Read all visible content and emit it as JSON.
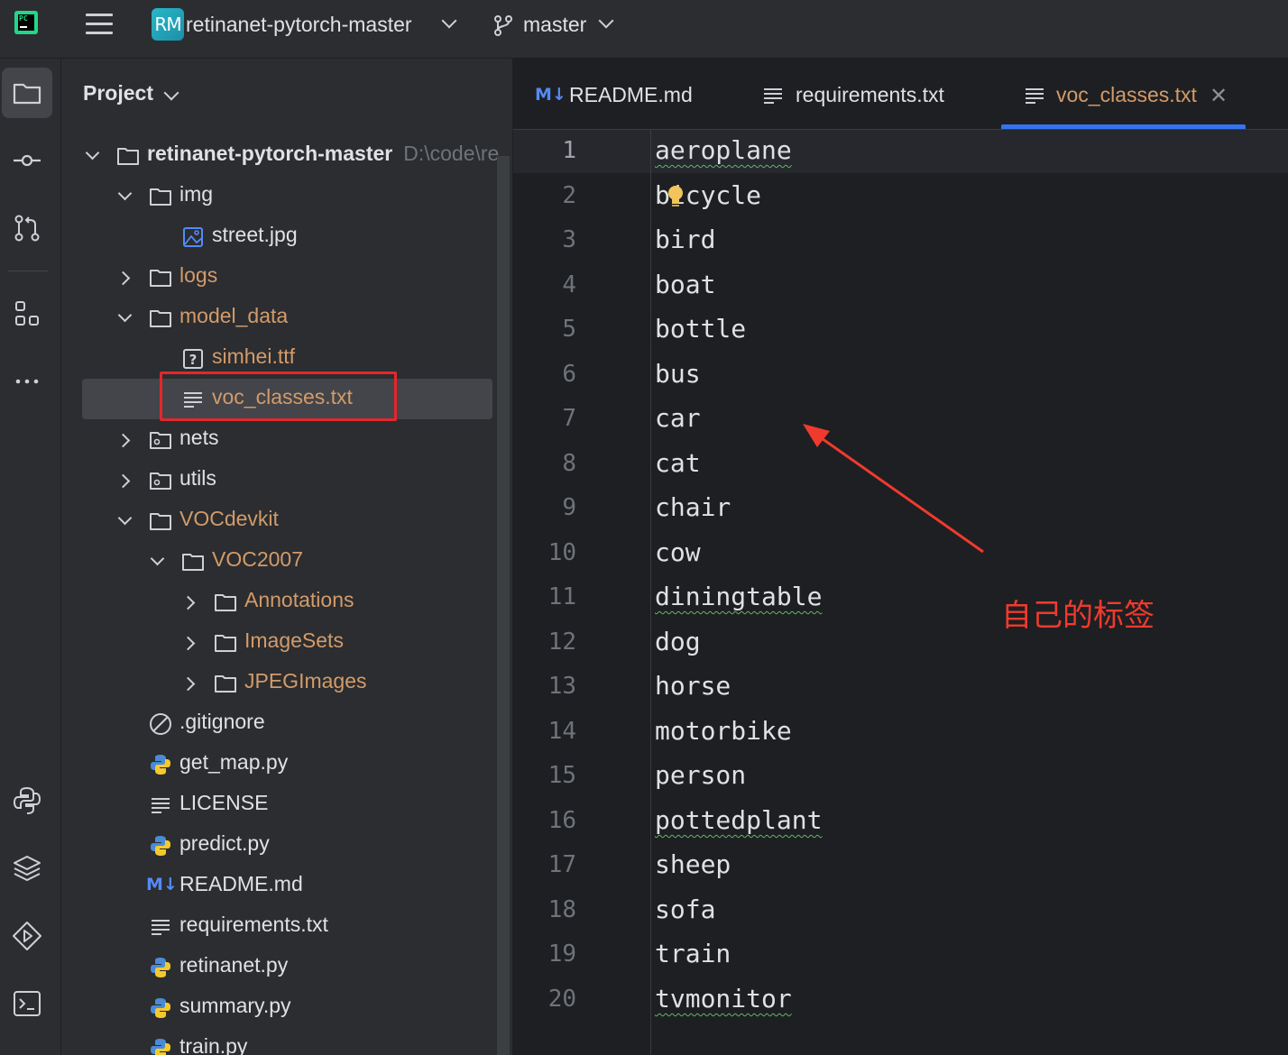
{
  "topbar": {
    "app_logo_text": "PC",
    "project_badge": "RM",
    "project_name": "retinanet-pytorch-master",
    "branch": "master"
  },
  "toolstrip": {
    "items": [
      "project-icon",
      "commit-icon",
      "pull-requests-icon",
      "structure-icon",
      "more-icon",
      "python-console-icon",
      "layers-icon",
      "run-icon",
      "terminal-icon"
    ]
  },
  "project_panel": {
    "title": "Project",
    "root": {
      "name": "retinanet-pytorch-master",
      "path": "D:\\code\\re"
    },
    "items": [
      {
        "name": "img"
      },
      {
        "name": "street.jpg"
      },
      {
        "name": "logs"
      },
      {
        "name": "model_data"
      },
      {
        "name": "simhei.ttf"
      },
      {
        "name": "voc_classes.txt"
      },
      {
        "name": "nets"
      },
      {
        "name": "utils"
      },
      {
        "name": "VOCdevkit"
      },
      {
        "name": "VOC2007"
      },
      {
        "name": "Annotations"
      },
      {
        "name": "ImageSets"
      },
      {
        "name": "JPEGImages"
      },
      {
        "name": ".gitignore"
      },
      {
        "name": "get_map.py"
      },
      {
        "name": "LICENSE"
      },
      {
        "name": "predict.py"
      },
      {
        "name": "README.md"
      },
      {
        "name": "requirements.txt"
      },
      {
        "name": "retinanet.py"
      },
      {
        "name": "summary.py"
      },
      {
        "name": "train.py"
      }
    ]
  },
  "tabs": [
    {
      "label": "README.md",
      "badge": "M↓"
    },
    {
      "label": "requirements.txt"
    },
    {
      "label": "voc_classes.txt",
      "close": "✕",
      "active": true
    }
  ],
  "editor": {
    "line_numbers": [
      "1",
      "2",
      "3",
      "4",
      "5",
      "6",
      "7",
      "8",
      "9",
      "10",
      "11",
      "12",
      "13",
      "14",
      "15",
      "16",
      "17",
      "18",
      "19",
      "20"
    ],
    "lines": [
      "aeroplane",
      "bicycle",
      "bird",
      "boat",
      "bottle",
      "bus",
      "car",
      "cat",
      "chair",
      "cow",
      "diningtable",
      "dog",
      "horse",
      "motorbike",
      "person",
      "pottedplant",
      "sheep",
      "sofa",
      "train",
      "tvmonitor"
    ]
  },
  "annotation": {
    "note": "自己的标签",
    "color": "#f03a2e"
  },
  "colors": {
    "accent": "#3574f0",
    "folder_orange": "#d39b6a",
    "highlight_red": "#e5262b"
  }
}
